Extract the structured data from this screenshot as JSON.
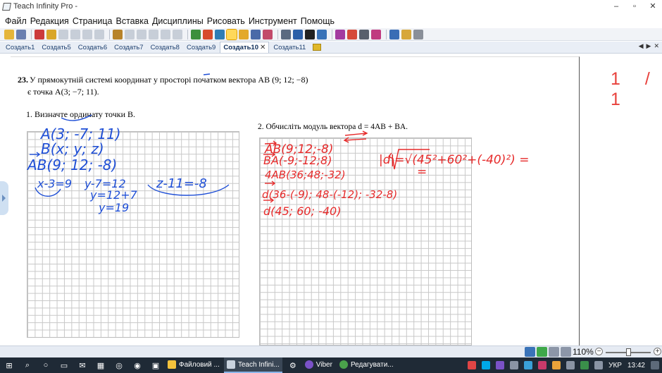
{
  "window": {
    "title": "Teach Infinity Pro -",
    "minimize": "–",
    "restore": "▫",
    "close": "✕"
  },
  "menu": [
    "Файл",
    "Редакция",
    "Страница",
    "Вставка",
    "Дисциплины",
    "Рисовать",
    "Инструмент",
    "Помощь"
  ],
  "tabs": {
    "items": [
      "Создать1",
      "Создать5",
      "Создать6",
      "Создать7",
      "Создать8",
      "Создать9",
      "Создать10",
      "Создать11"
    ],
    "active_index": 6,
    "close_glyph": "✕",
    "nav": [
      "◀",
      "▶",
      "✕"
    ]
  },
  "page_counter": "1 / 1",
  "problem": {
    "number": "23.",
    "line1": "У прямокутній системі координат у просторі початком вектора  AB (9; 12; −8)",
    "line2": "є точка A(3; −7; 11).",
    "task1": "1.   Визначте ординату точки B.",
    "task2": "2.   Обчисліть модуль вектора  d = 4AB + BA."
  },
  "handwriting": {
    "left": [
      "A(3; -7; 11)",
      "B(x; y; z)",
      "AB(9; 12; -8)",
      "x-3=9",
      "y-7=12",
      "y=12+7",
      "y=19",
      "z-11=-8"
    ],
    "right": [
      "AB(9;12;-8)",
      "BA(-9;-12;8)",
      "4AB(36;48;-32)",
      "d(36-(-9); 48-(-12); -32-8)",
      "d(45; 60; -40)",
      "|d|=√(45²+60²+(-40)²) =",
      "="
    ]
  },
  "status": {
    "zoom": "110%",
    "zoom_minus": "−",
    "zoom_plus": "+",
    "zoom_level_percent": 110
  },
  "taskbar": {
    "apps": [
      {
        "label": "Файловий ...",
        "color": "#f3c23c"
      },
      {
        "label": "Teach Infini...",
        "color": "#c9d3df"
      },
      {
        "label": "Viber",
        "color": "#7a52c7"
      },
      {
        "label": "Редагувати...",
        "color": "#4aa14b"
      }
    ],
    "active_index": 1,
    "lang": "УКР",
    "time": "13:42"
  },
  "colors": {
    "ink_blue": "#1f4fd6",
    "ink_red": "#e62a2a",
    "page_counter": "#e8413c",
    "taskbar": "#1f2a36"
  }
}
